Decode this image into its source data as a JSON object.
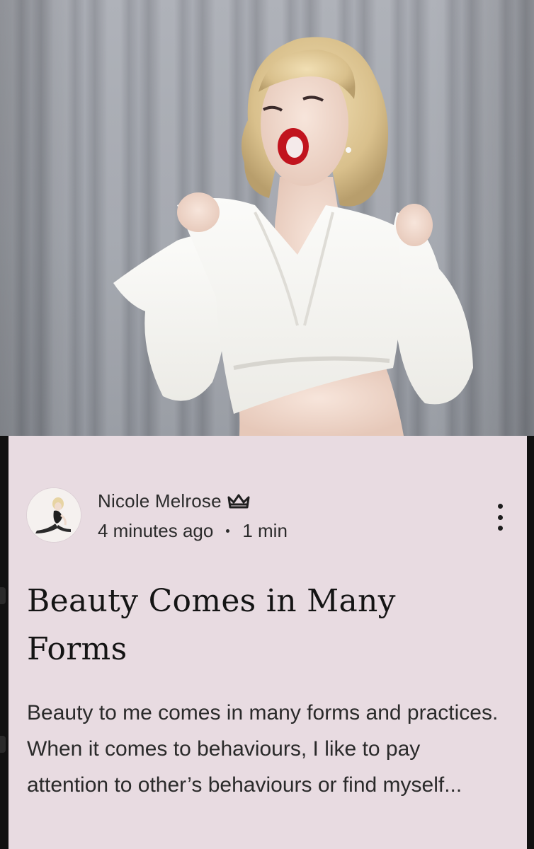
{
  "hero": {
    "image_alt": "Woman with platinum blonde hair and red lips in a white blouse against a grey curtain"
  },
  "post": {
    "author": {
      "name": "Nicole Melrose",
      "badge_icon": "crown-icon"
    },
    "time_ago": "4 minutes ago",
    "read_time": "1 min",
    "more_icon": "more-vertical-icon",
    "title": "Beauty Comes in Many Forms",
    "excerpt": "Beauty to me comes in many forms and practices. When it comes to behaviours, I like to pay attention to other’s behaviours or find myself..."
  },
  "colors": {
    "card_background": "#e8dbe1",
    "text_primary": "#141414",
    "text_secondary": "#2b2b2b",
    "page_background": "#111111"
  }
}
